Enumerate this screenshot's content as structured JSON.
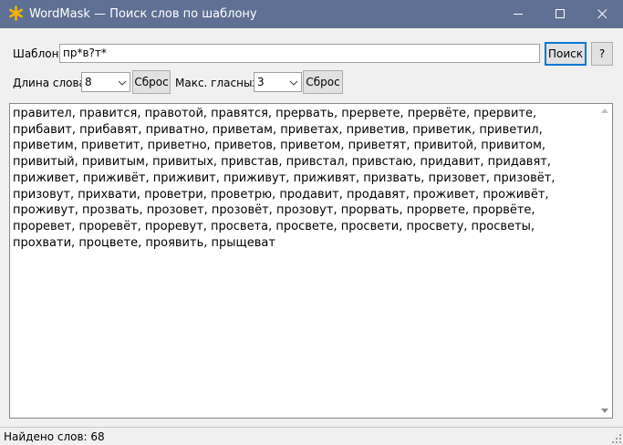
{
  "window": {
    "title": "WordMask — Поиск слов по шаблону",
    "icon": "asterisk-star-icon",
    "accent_color": "#5e7093"
  },
  "controls": {
    "pattern_label": "Шаблон:",
    "pattern_value": "пр*в?т*",
    "search_label": "Поиск",
    "help_label": "?",
    "length_label": "Длина слова:",
    "length_value": "8",
    "reset_label": "Сброс",
    "vowels_label": "Макс. гласных:",
    "vowels_value": "3"
  },
  "results": {
    "text": "правител, правится, правотой, правятся, прервать, прервете, прервёте, прервите, прибавит, прибавят, приватно, приветам, приветах, приветив, приветик, приветил, приветим, приветит, приветно, приветов, приветом, приветят, привитой, привитом, привитый, привитым, привитых, привстав, привстал, привстаю, придавит, придавят, приживет, приживёт, приживит, приживут, приживят, призвать, призовет, призовёт, призовут, прихвати, проветри, проветрю, продавит, продавят, проживет, проживёт, проживут, прозвать, прозовет, прозовёт, прозовут, прорвать, прорвете, прорвёте, проревет, проревёт, проревут, просвета, просвете, просвети, просвету, просветы, прохвати, процвете, проявить, прыщеват"
  },
  "status": {
    "found_text": "Найдено слов: 68"
  }
}
